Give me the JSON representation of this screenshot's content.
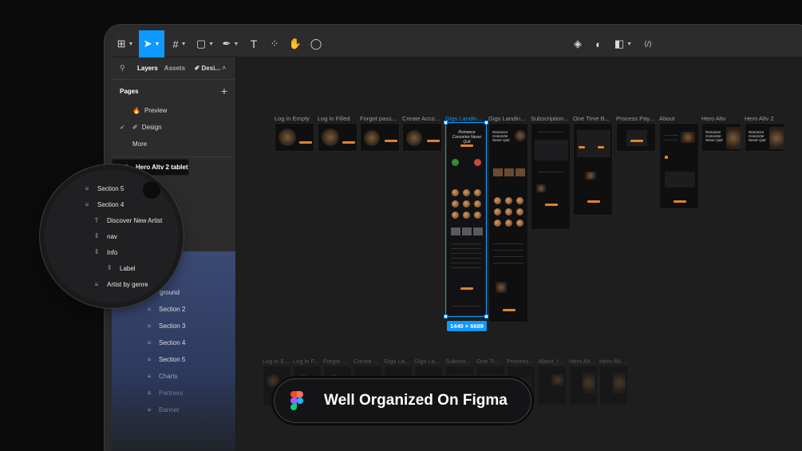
{
  "toolbar": {
    "tools": [
      {
        "name": "main-menu",
        "icon": "figma-grid-icon",
        "glyph": "⊞",
        "caret": true
      },
      {
        "name": "move",
        "icon": "cursor-icon",
        "glyph": "➤",
        "caret": true,
        "active": true
      },
      {
        "name": "frame",
        "icon": "frame-icon",
        "glyph": "#",
        "caret": true
      },
      {
        "name": "shape",
        "icon": "rectangle-icon",
        "glyph": "▢",
        "caret": true
      },
      {
        "name": "pen",
        "icon": "pen-icon",
        "glyph": "✒",
        "caret": true
      },
      {
        "name": "text",
        "icon": "text-icon",
        "glyph": "T",
        "caret": false
      },
      {
        "name": "resources",
        "icon": "components-icon",
        "glyph": "⁘",
        "caret": false
      },
      {
        "name": "hand",
        "icon": "hand-icon",
        "glyph": "✋",
        "caret": false
      },
      {
        "name": "comment",
        "icon": "comment-icon",
        "glyph": "◯",
        "caret": false
      }
    ],
    "right_tools": [
      {
        "name": "component",
        "icon": "component-icon",
        "glyph": "◈"
      },
      {
        "name": "mask",
        "icon": "contrast-icon",
        "glyph": "◐"
      },
      {
        "name": "boolean",
        "icon": "boolean-icon",
        "glyph": "◧"
      },
      {
        "name": "dev-mode",
        "icon": "code-icon",
        "glyph": "⟨/⟩"
      }
    ]
  },
  "panel": {
    "tabs": {
      "layers": "Layers",
      "assets": "Assets",
      "design": "Desi..."
    },
    "pages_title": "Pages",
    "pages": [
      {
        "emoji": "🔥",
        "label": "Preview",
        "checked": false
      },
      {
        "emoji": "✐",
        "label": "Design",
        "checked": true
      },
      {
        "emoji": "",
        "label": "More",
        "checked": false
      }
    ],
    "frame_layer": "Hero Altv 2 tablet",
    "peek_layer_1": "age",
    "peek_layer_2": "ground",
    "layers": [
      {
        "label": "Section 2",
        "tone": "normal"
      },
      {
        "label": "Section 3",
        "tone": "normal"
      },
      {
        "label": "Section 4",
        "tone": "normal"
      },
      {
        "label": "Section 5",
        "tone": "normal"
      },
      {
        "label": "Charts",
        "tone": "dim"
      },
      {
        "label": "Partners",
        "tone": "dimmer"
      },
      {
        "label": "Banner",
        "tone": "dimmer"
      }
    ]
  },
  "canvas": {
    "top_labels": [
      "Log in Empty",
      "Log in Filled",
      "Forgot pass...",
      "Create Acco...",
      "Gigs Landin...",
      "Gigs Landin...",
      "Subscription...",
      "One Time B...",
      "Process Pay...",
      "About",
      "Hero Altv",
      "Hero Altv 2"
    ],
    "bottom_labels": [
      "Log in E...",
      "Log in F...",
      "Forgot ...",
      "Create ...",
      "Gigs La...",
      "Gigs La...",
      "Subscri...",
      "One Ti...",
      "Process...",
      "About_t...",
      "Hero Alt...",
      "Hero Alt..."
    ],
    "dimension_badge": "1440 × 6689",
    "frame_headline": "Romance Concertor Never Quit"
  },
  "magnifier": {
    "items": [
      {
        "label": "Section 5",
        "icon": "≡"
      },
      {
        "label": "Section 4",
        "icon": "≡"
      },
      {
        "label": "Discover New Artist",
        "icon": "T"
      },
      {
        "label": "nav",
        "icon": "⫴"
      },
      {
        "label": "Info",
        "icon": "⫴"
      },
      {
        "label": "Label",
        "icon": "⫴"
      },
      {
        "label": "Artist by genre",
        "icon": "≡"
      }
    ]
  },
  "caption": {
    "text": "Well Organized On Figma"
  },
  "colors": {
    "accent": "#0d99ff",
    "orange": "#e0822c",
    "background": "#0b0b0c"
  }
}
